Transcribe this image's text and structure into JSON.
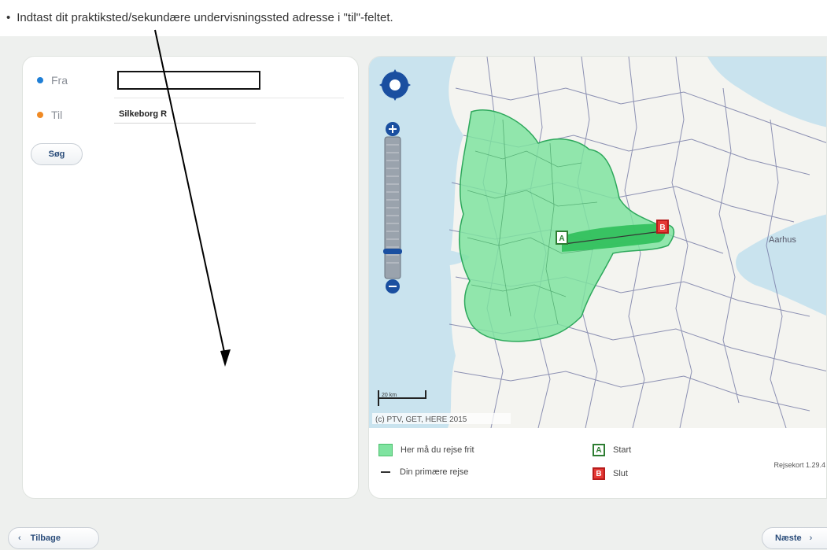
{
  "instruction": "Indtast dit praktiksted/sekundære undervisningssted adresse i \"til\"-feltet.",
  "form": {
    "fra_label": "Fra",
    "fra_value": "",
    "til_label": "Til",
    "til_value": "Silkeborg R",
    "search_label": "Søg"
  },
  "map": {
    "scale_label": "20 km",
    "attribution": "(c) PTV, GET, HERE 2015",
    "marker_a": "A",
    "marker_b": "B",
    "city_label": "Aarhus"
  },
  "legend": {
    "free_travel": "Her må du rejse frit",
    "primary_route": "Din primære rejse",
    "start": "Start",
    "end": "Slut"
  },
  "version": "Rejsekort 1.29.4",
  "nav": {
    "back_label": "Tilbage",
    "next_label": "Næste"
  },
  "colors": {
    "zone_fill": "#7fe3a0",
    "sea": "#c9e3ee",
    "marker_a": "#2e7d32",
    "marker_b": "#e53935"
  }
}
